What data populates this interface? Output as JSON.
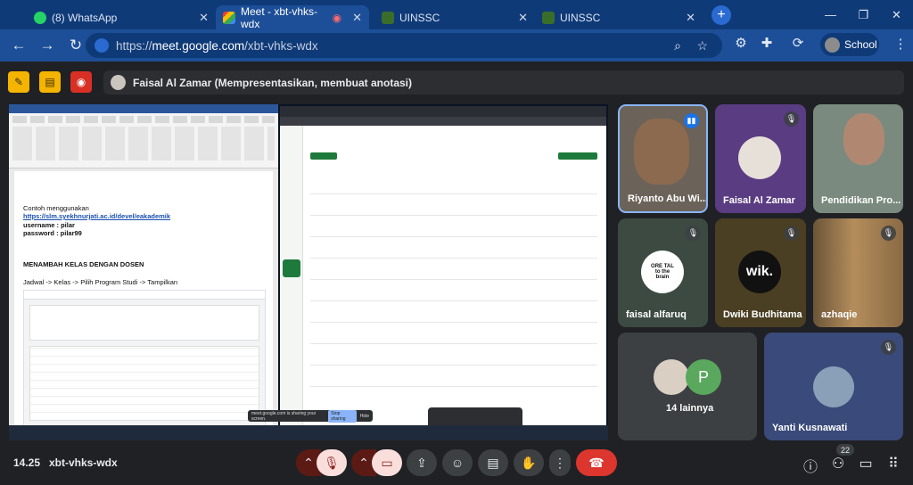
{
  "tabs": [
    {
      "label": "(8) WhatsApp",
      "color": "#25d366"
    },
    {
      "label": "Meet - xbt-vhks-wdx",
      "color": "#00ac47"
    },
    {
      "label": "UINSSC",
      "color": "#3b6d2a"
    },
    {
      "label": "UINSSC",
      "color": "#3b6d2a"
    }
  ],
  "address": {
    "scheme": "https://",
    "host": "meet.google.com",
    "path": "/xbt-vhks-wdx"
  },
  "profile": {
    "label": "School"
  },
  "presenter": {
    "text": "Faisal Al Zamar (Mempresentasikan, membuat anotasi)"
  },
  "document": {
    "line1": "Contoh menggunakan",
    "link": "https://slm.syekhnurjati.ac.id/devel/eakademik",
    "username": "username : pilar",
    "password": "password : pilar99",
    "heading": "MENAMBAH KELAS DENGAN DOSEN",
    "steps": "Jadwal -> Kelas -> Pilih Program Studi -> Tampilkan"
  },
  "share_banner": {
    "text": "meet.google.com is sharing your screen.",
    "stop": "Stop sharing",
    "hide": "Hide"
  },
  "participants": [
    {
      "name": "Riyanto Abu Wi...",
      "bg": "#6b6359",
      "speaking": true
    },
    {
      "name": "Faisal Al Zamar",
      "bg": "#5a3c82",
      "muted": true
    },
    {
      "name": "Pendidikan Pro...",
      "bg": "#7a8a7e"
    },
    {
      "name": "faisal alfaruq",
      "bg": "#3c4a42",
      "muted": true
    },
    {
      "name": "Dwiki Budhitama",
      "bg": "#4a3f22",
      "muted": true
    },
    {
      "name": "azhaqie",
      "bg": "#7a5e3e",
      "muted": true
    },
    {
      "name": "14 lainnya",
      "bg": "#3c4043"
    },
    {
      "name": "Yanti Kusnawati",
      "bg": "#3a4a7a"
    }
  ],
  "others": {
    "initial": "P",
    "initial_color": "#5aa85e"
  },
  "tiles_text": {
    "wik": "wik.",
    "tal1": "ORE TAL",
    "tal2": "to the",
    "tal3": "brain"
  },
  "meeting": {
    "time": "14.25",
    "code": "xbt-vhks-wdx",
    "participant_count": "22"
  }
}
